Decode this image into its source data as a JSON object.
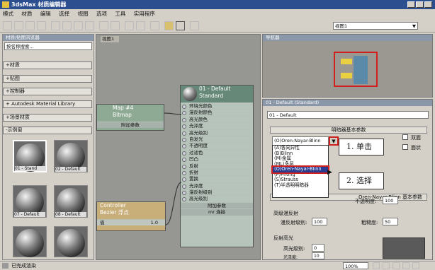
{
  "window": {
    "title": "3dsMax 材质编辑器"
  },
  "menu": [
    "模式",
    "材质",
    "编辑",
    "选择",
    "视图",
    "选项",
    "工具",
    "实用程序"
  ],
  "toolbar": {
    "view_dropdown": "视图1"
  },
  "left_panel": {
    "header": "材质/贴图浏览器",
    "search_placeholder": "按名称搜索...",
    "rollouts": [
      "+材质",
      "+贴图",
      "+控制器",
      "+ Autodesk Material Library",
      "+场景材质",
      "-示例窗"
    ],
    "samples": [
      "01 - Stand",
      "02 - Default",
      "07 - Default",
      "08 - Default"
    ]
  },
  "center_panel": {
    "tab": "视图1",
    "node_main": {
      "title": "01 - Default",
      "subtitle": "Standard",
      "slots": [
        "环境光颜色",
        "漫反射颜色",
        "高光颜色",
        "光泽度",
        "高光级别",
        "自发光",
        "不透明度",
        "过滤色",
        "凹凸",
        "反射",
        "折射",
        "置换",
        "光泽度",
        "漫反射级别",
        "高光级别"
      ],
      "footer": [
        "附加参数",
        "mr 连接"
      ]
    },
    "node_map": {
      "title": "Map #4",
      "subtitle": "Bitmap",
      "footer": "附加参数"
    },
    "node_ctrl": {
      "title": "Controller",
      "subtitle": "Bezier 浮点",
      "value_label": "值",
      "value": "1.0"
    }
  },
  "right_panel": {
    "nav_header": "导航器",
    "params_header": "01 - Default (Standard)",
    "material_name": "01 - Default",
    "shader_header": "明暗器基本参数",
    "shader_value": "(O)Oren-Nayar-Blinn",
    "checkboxes": [
      "双面",
      "面状"
    ],
    "dropdown_items": [
      "(A)各向异性",
      "(B)Blinn",
      "(M)金属",
      "(ML)多层",
      "(O)Oren-Nayar-Blinn",
      "(P)Phong",
      "(S)Strauss",
      "(T)半透明明暗器"
    ],
    "basic_header": "Oren-Nayar-Blinn 基本参数",
    "opacity_label": "不透明度:",
    "opacity_value": "100",
    "specular_header": "高级漫反射",
    "diffuse_level_label": "漫反射级别:",
    "diffuse_level_value": "100",
    "roughness_label": "粗糙度:",
    "roughness_value": "50",
    "reflect_header": "反射高光",
    "spec_level_label": "高光级别:",
    "spec_level_value": "0",
    "gloss_label": "光泽度:",
    "gloss_value": "10"
  },
  "callouts": {
    "step1": "1. 单击",
    "step2": "2. 选择"
  },
  "status": {
    "text": "已完成渲染",
    "zoom": "100%"
  },
  "colors": {
    "title_bar": "#2c4f8f",
    "callout_red": "#d02020",
    "selection": "#2a3b8f"
  }
}
